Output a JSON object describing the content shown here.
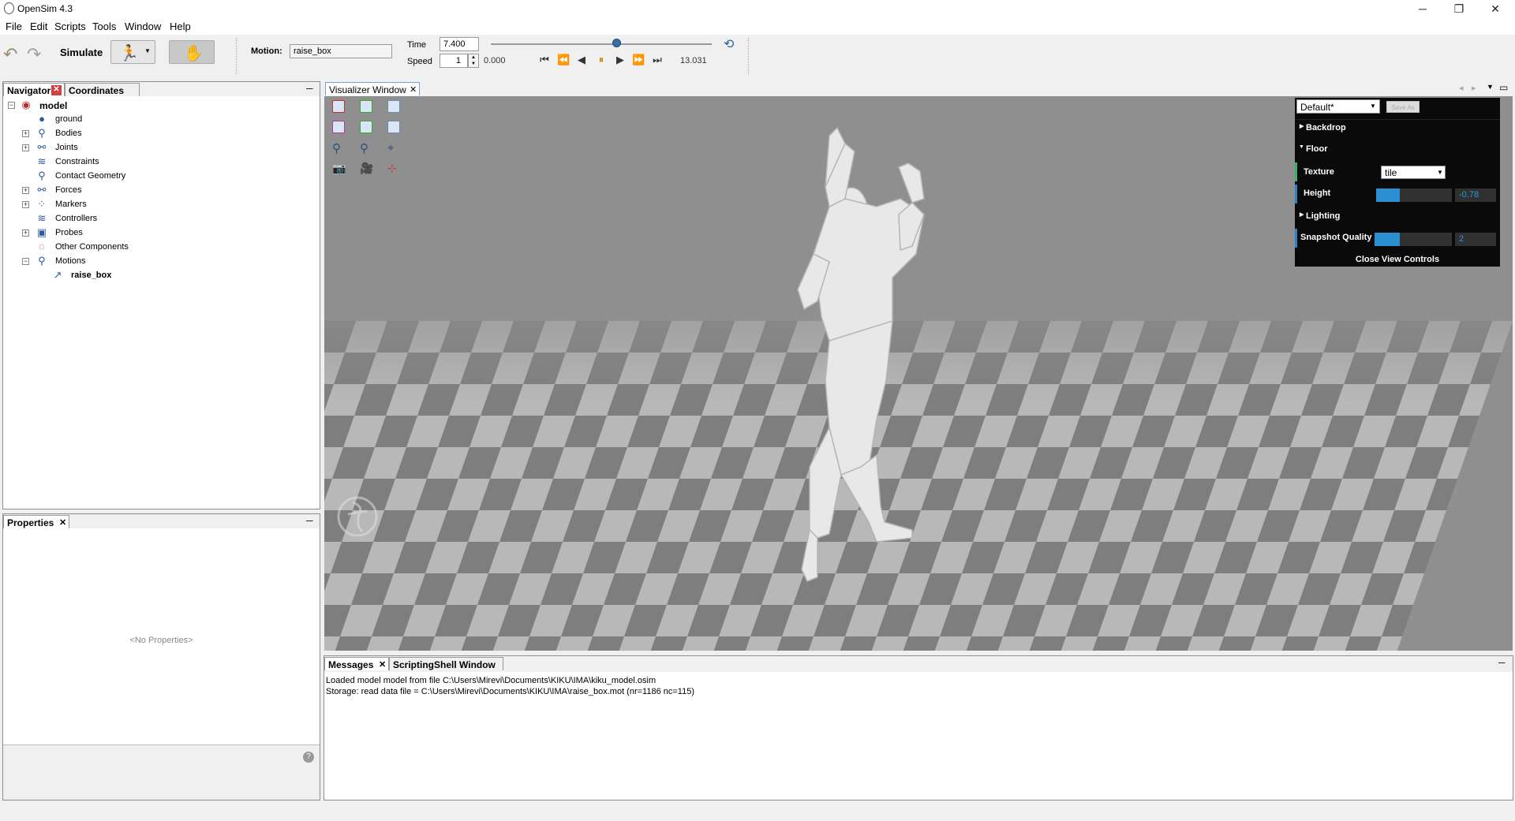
{
  "app": {
    "title": "OpenSim 4.3"
  },
  "window_controls": {
    "minimize": "─",
    "restore": "❐",
    "close": "✕"
  },
  "menu": [
    "File",
    "Edit",
    "Scripts",
    "Tools",
    "Window",
    "Help"
  ],
  "toolbar": {
    "simulate_label": "Simulate",
    "motion_label": "Motion:",
    "motion_value": "raise_box",
    "time_label": "Time",
    "time_value": "7.400",
    "speed_label": "Speed",
    "speed_value": "1",
    "start_time": "0.000",
    "end_time": "13.031",
    "time_slider_fraction": 0.568
  },
  "navigator": {
    "tabs": [
      "Navigator",
      "Coordinates"
    ],
    "root": "model",
    "items": [
      {
        "label": "ground",
        "icon": "ground-icon"
      },
      {
        "label": "Bodies",
        "icon": "bodies-icon"
      },
      {
        "label": "Joints",
        "icon": "joints-icon"
      },
      {
        "label": "Constraints",
        "icon": "constraints-icon"
      },
      {
        "label": "Contact Geometry",
        "icon": "contact-geometry-icon"
      },
      {
        "label": "Forces",
        "icon": "forces-icon"
      },
      {
        "label": "Markers",
        "icon": "markers-icon"
      },
      {
        "label": "Controllers",
        "icon": "controllers-icon"
      },
      {
        "label": "Probes",
        "icon": "probes-icon"
      },
      {
        "label": "Other Components",
        "icon": "components-icon"
      },
      {
        "label": "Motions",
        "icon": "motions-icon"
      },
      {
        "label": "raise_box",
        "icon": "motion-file-icon"
      }
    ]
  },
  "properties": {
    "tab": "Properties",
    "empty": "<No Properties>"
  },
  "visualizer": {
    "tab": "Visualizer Window"
  },
  "view_controls": {
    "preset": "Default*",
    "save_as": "Save As",
    "backdrop": "Backdrop",
    "floor": "Floor",
    "texture_label": "Texture",
    "texture_value": "tile",
    "height_label": "Height",
    "height_value": "-0.78",
    "lighting": "Lighting",
    "snapshot_label": "Snapshot Quality",
    "snapshot_value": "2",
    "close": "Close View Controls"
  },
  "messages": {
    "tabs": [
      "Messages",
      "ScriptingShell Window"
    ],
    "lines": [
      "Loaded model model from file C:\\Users\\Mirevi\\Documents\\KIKU\\IMA\\kiku_model.osim",
      "Storage: read data file = C:\\Users\\Mirevi\\Documents\\KIKU\\IMA\\raise_box.mot (nr=1186 nc=115)"
    ]
  }
}
